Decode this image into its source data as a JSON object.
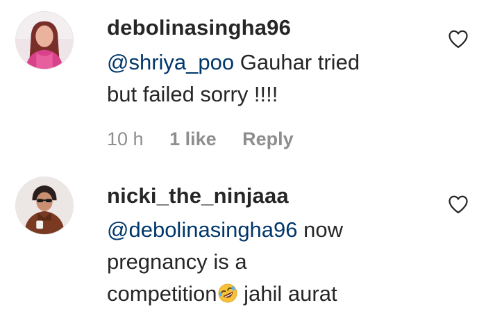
{
  "comments": [
    {
      "username": "debolinasingha96",
      "mention": "@shriya_poo",
      "text_line1": " Gauhar tried",
      "text_line2": "but failed sorry !!!!",
      "time": "10 h",
      "likes": "1 like",
      "reply": "Reply",
      "avatar_icon": "profile-photo-woman-pink",
      "like_icon": "heart-outline-icon"
    },
    {
      "username": "nicki_the_ninjaaa",
      "mention": "@debolinasingha96",
      "text_line1": " now",
      "text_line2": "pregnancy is a",
      "text_line3a": "competition",
      "emoji": "rolling-on-floor-laughing-emoji",
      "text_line3b": " jahil aurat",
      "avatar_icon": "profile-photo-woman-sunglasses",
      "like_icon": "heart-outline-icon"
    }
  ],
  "colors": {
    "text": "#262626",
    "mention": "#00376b",
    "meta": "#8e8e8e"
  }
}
